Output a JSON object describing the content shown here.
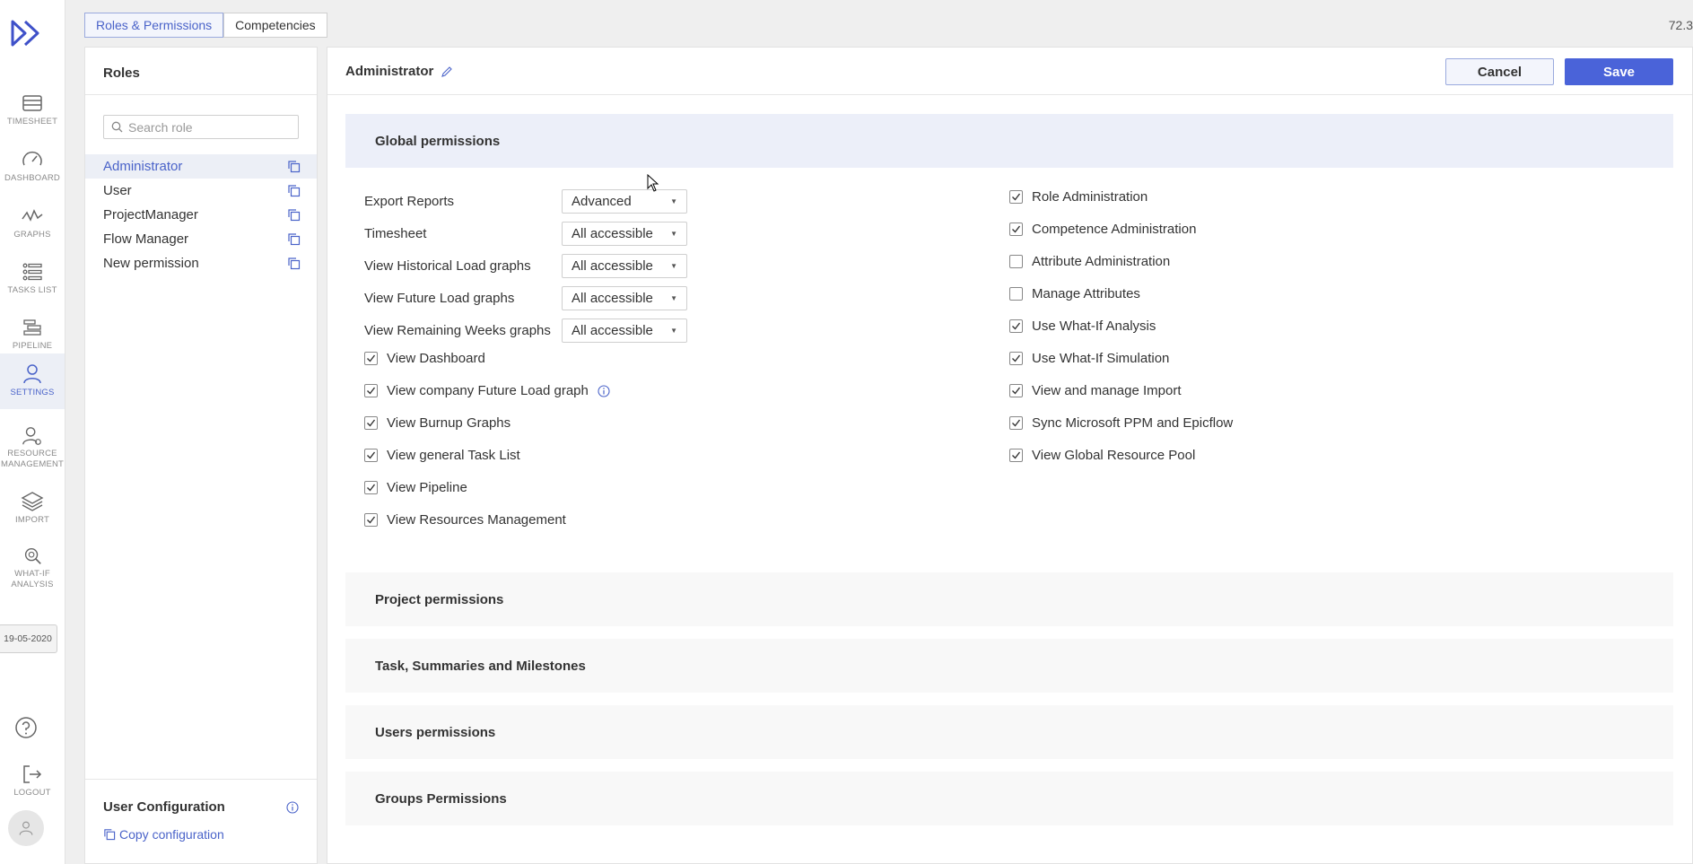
{
  "app": {
    "version": "72.3"
  },
  "nav": {
    "items": [
      {
        "label": "TIMESHEET",
        "icon": "timesheet-icon"
      },
      {
        "label": "DASHBOARD",
        "icon": "dashboard-gauge-icon"
      },
      {
        "label": "GRAPHS",
        "icon": "graphs-icon"
      },
      {
        "label": "TASKS LIST",
        "icon": "tasks-list-icon"
      },
      {
        "label": "PIPELINE",
        "icon": "pipeline-icon"
      },
      {
        "label": "SETTINGS",
        "icon": "settings-user-icon",
        "active": true
      },
      {
        "label": "RESOURCE MANAGEMENT",
        "icon": "resource-management-icon"
      },
      {
        "label": "IMPORT",
        "icon": "import-layers-icon"
      },
      {
        "label": "WHAT-IF ANALYSIS",
        "icon": "what-if-analysis-icon"
      },
      {
        "label": "LOGOUT",
        "icon": "logout-icon"
      }
    ],
    "date": "19-05-2020"
  },
  "tabs": [
    {
      "label": "Roles & Permissions",
      "active": true
    },
    {
      "label": "Competencies",
      "active": false
    }
  ],
  "roles": {
    "title": "Roles",
    "search_placeholder": "Search role",
    "items": [
      "Administrator",
      "User",
      "ProjectManager",
      "Flow Manager",
      "New permission"
    ],
    "selected": "Administrator",
    "user_config_title": "User Configuration",
    "copy_config_label": "Copy configuration"
  },
  "main": {
    "role_name": "Administrator",
    "cancel_label": "Cancel",
    "save_label": "Save",
    "sections": {
      "global": "Global permissions",
      "project": "Project permissions",
      "tasks": "Task, Summaries and Milestones",
      "users": "Users permissions",
      "groups": "Groups Permissions"
    },
    "dropdown_perms": [
      {
        "label": "Export Reports",
        "value": "Advanced"
      },
      {
        "label": "Timesheet",
        "value": "All accessible"
      },
      {
        "label": "View Historical Load graphs",
        "value": "All accessible"
      },
      {
        "label": "View Future Load graphs",
        "value": "All accessible"
      },
      {
        "label": "View Remaining Weeks graphs",
        "value": "All accessible"
      }
    ],
    "left_checks": [
      {
        "label": "View Dashboard",
        "checked": true
      },
      {
        "label": "View company Future Load graph",
        "checked": true,
        "info": true
      },
      {
        "label": "View Burnup Graphs",
        "checked": true
      },
      {
        "label": "View general Task List",
        "checked": true
      },
      {
        "label": "View Pipeline",
        "checked": true
      },
      {
        "label": "View Resources Management",
        "checked": true
      }
    ],
    "right_checks": [
      {
        "label": "Role Administration",
        "checked": true
      },
      {
        "label": "Competence Administration",
        "checked": true
      },
      {
        "label": "Attribute Administration",
        "checked": false
      },
      {
        "label": "Manage Attributes",
        "checked": false
      },
      {
        "label": "Use What-If Analysis",
        "checked": true
      },
      {
        "label": "Use What-If Simulation",
        "checked": true
      },
      {
        "label": "View and manage Import",
        "checked": true
      },
      {
        "label": "Sync Microsoft PPM and Epicflow",
        "checked": true
      },
      {
        "label": "View Global Resource Pool",
        "checked": true
      }
    ]
  },
  "colors": {
    "accent": "#4a63d9",
    "active_bg": "#eceff6"
  }
}
